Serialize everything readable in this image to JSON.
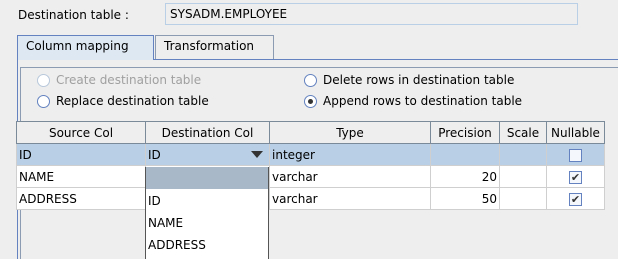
{
  "destination": {
    "label": "Destination table :",
    "value": "SYSADM.EMPLOYEE"
  },
  "tabs": [
    {
      "label": "Column mapping",
      "active": true
    },
    {
      "label": "Transformation",
      "active": false
    }
  ],
  "options": {
    "create_dest": {
      "label": "Create destination table",
      "selected": false,
      "enabled": false
    },
    "replace_dest": {
      "label": "Replace destination table",
      "selected": false,
      "enabled": true
    },
    "delete_rows": {
      "label": "Delete rows in destination table",
      "selected": false,
      "enabled": true
    },
    "append_rows": {
      "label": "Append rows to destination table",
      "selected": true,
      "enabled": true
    }
  },
  "table": {
    "headers": [
      "Source Col",
      "Destination Col",
      "Type",
      "Precision",
      "Scale",
      "Nullable"
    ],
    "rows": [
      {
        "source": "ID",
        "dest": "ID",
        "type": "integer",
        "precision": "",
        "scale": "",
        "nullable": false
      },
      {
        "source": "NAME",
        "dest": "",
        "type": "varchar",
        "precision": "20",
        "scale": "",
        "nullable": true
      },
      {
        "source": "ADDRESS",
        "dest": "",
        "type": "varchar",
        "precision": "50",
        "scale": "",
        "nullable": true
      }
    ]
  },
  "dropdown": {
    "items": [
      "",
      "ID",
      "NAME",
      "ADDRESS"
    ]
  },
  "colors": {
    "selection": "#b8cfe5",
    "highlight": "#a8b8c8",
    "accent": "#6382bf"
  }
}
